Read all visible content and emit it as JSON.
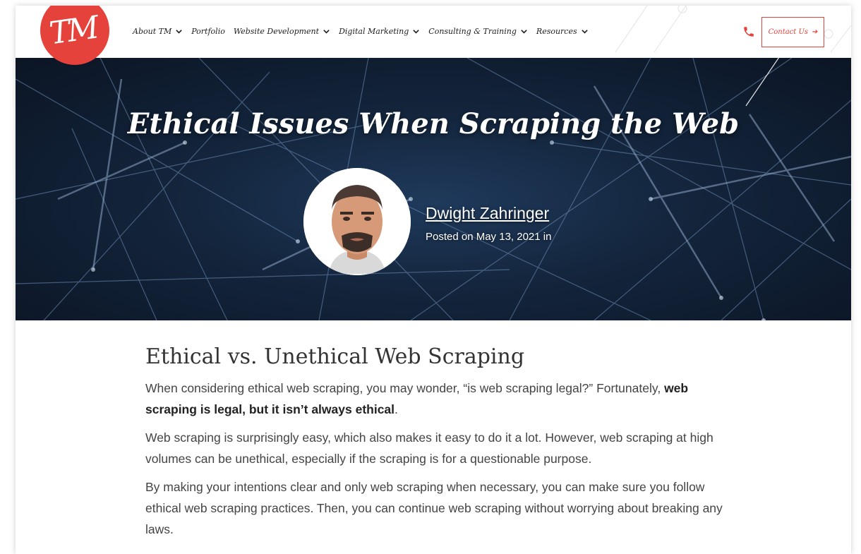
{
  "header": {
    "logo_text": "TM",
    "nav": [
      {
        "label": "About TM",
        "dropdown": true
      },
      {
        "label": "Portfolio",
        "dropdown": false
      },
      {
        "label": "Website Development",
        "dropdown": true
      },
      {
        "label": "Digital Marketing",
        "dropdown": true
      },
      {
        "label": "Consulting & Training",
        "dropdown": true
      },
      {
        "label": "Resources",
        "dropdown": true
      }
    ],
    "phone_icon": "phone-icon",
    "contact_label": "Contact Us",
    "contact_arrow": "➔"
  },
  "hero": {
    "title": "Ethical Issues When Scraping the Web",
    "author": "Dwight Zahringer",
    "posted": "Posted on May 13, 2021 in"
  },
  "article": {
    "heading": "Ethical vs. Unethical Web Scraping",
    "p1_text": "When considering ethical web scraping, you may wonder, “is web scraping legal?” Fortunately,",
    "p1_bold": "web scraping is legal, but it isn’t always ethical",
    "p1_end": ".",
    "p2": "Web scraping is surprisingly easy, which also makes it easy to do it a lot. However, web scraping at high volumes can be unethical, especially if the scraping is for a questionable purpose.",
    "p3": "By making your intentions clear and only web scraping when necessary, you can make sure you follow ethical web scraping practices. Then, you can continue web scraping without worrying about breaking any laws."
  },
  "colors": {
    "accent": "#e4423a",
    "hero_bg": "#13243b"
  }
}
